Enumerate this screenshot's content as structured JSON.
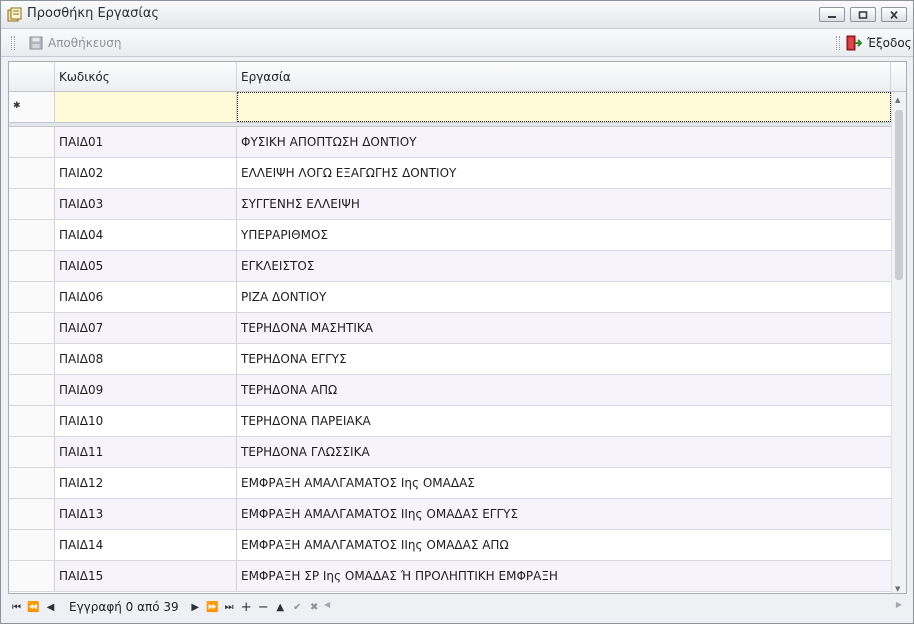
{
  "window": {
    "title": "Προσθήκη Εργασίας"
  },
  "toolbar": {
    "save_label": "Αποθήκευση",
    "exit_label": "Έξοδος"
  },
  "grid": {
    "columns": [
      "Κωδικός",
      "Εργασία"
    ],
    "rows": [
      {
        "code": "ΠΑΙΔ01",
        "task": "ΦΥΣΙΚΗ ΑΠΟΠΤΩΣΗ ΔΟΝΤΙΟΥ"
      },
      {
        "code": "ΠΑΙΔ02",
        "task": "ΕΛΛΕΙΨΗ ΛΟΓΩ ΕΞΑΓΩΓΗΣ ΔΟΝΤΙΟΥ"
      },
      {
        "code": "ΠΑΙΔ03",
        "task": "ΣΥΓΓΕΝΗΣ ΕΛΛΕΙΨΗ"
      },
      {
        "code": "ΠΑΙΔ04",
        "task": "ΥΠΕΡΑΡΙΘΜΟΣ"
      },
      {
        "code": "ΠΑΙΔ05",
        "task": "ΕΓΚΛΕΙΣΤΟΣ"
      },
      {
        "code": "ΠΑΙΔ06",
        "task": "ΡΙΖΑ ΔΟΝΤΙΟΥ"
      },
      {
        "code": "ΠΑΙΔ07",
        "task": "ΤΕΡΗΔΟΝΑ ΜΑΣΗΤΙΚΑ"
      },
      {
        "code": "ΠΑΙΔ08",
        "task": "ΤΕΡΗΔΟΝΑ ΕΓΓΥΣ"
      },
      {
        "code": "ΠΑΙΔ09",
        "task": "ΤΕΡΗΔΟΝΑ ΑΠΩ"
      },
      {
        "code": "ΠΑΙΔ10",
        "task": "ΤΕΡΗΔΟΝΑ ΠΑΡΕΙΑΚΑ"
      },
      {
        "code": "ΠΑΙΔ11",
        "task": "ΤΕΡΗΔΟΝΑ ΓΛΩΣΣΙΚΑ"
      },
      {
        "code": "ΠΑΙΔ12",
        "task": "ΕΜΦΡΑΞΗ ΑΜΑΛΓΑΜΑΤΟΣ Iης ΟΜΑΔΑΣ"
      },
      {
        "code": "ΠΑΙΔ13",
        "task": "ΕΜΦΡΑΞΗ ΑΜΑΛΓΑΜΑΤΟΣ IIης ΟΜΑΔΑΣ ΕΓΓΥΣ"
      },
      {
        "code": "ΠΑΙΔ14",
        "task": "ΕΜΦΡΑΞΗ ΑΜΑΛΓΑΜΑΤΟΣ IIης ΟΜΑΔΑΣ ΑΠΩ"
      },
      {
        "code": "ΠΑΙΔ15",
        "task": "ΕΜΦΡΑΞΗ ΣΡ Iης ΟΜΑΔΑΣ Ή ΠΡΟΛΗΠΤΙΚΗ ΕΜΦΡΑΞΗ"
      }
    ]
  },
  "navigator": {
    "record_text": "Εγγραφή 0 από 39"
  },
  "icons": {
    "app": "window-app-icon",
    "minimize": "minimize-icon",
    "maximize": "maximize-icon",
    "close": "close-icon",
    "save": "save-disk-icon",
    "exit": "exit-door-icon",
    "new_row": "new-row-indicator-icon"
  },
  "colors": {
    "new_row_bg": "#fffbd9",
    "alt_row_bg": "#f6f3fa",
    "exit_icon": "#c8252a"
  }
}
